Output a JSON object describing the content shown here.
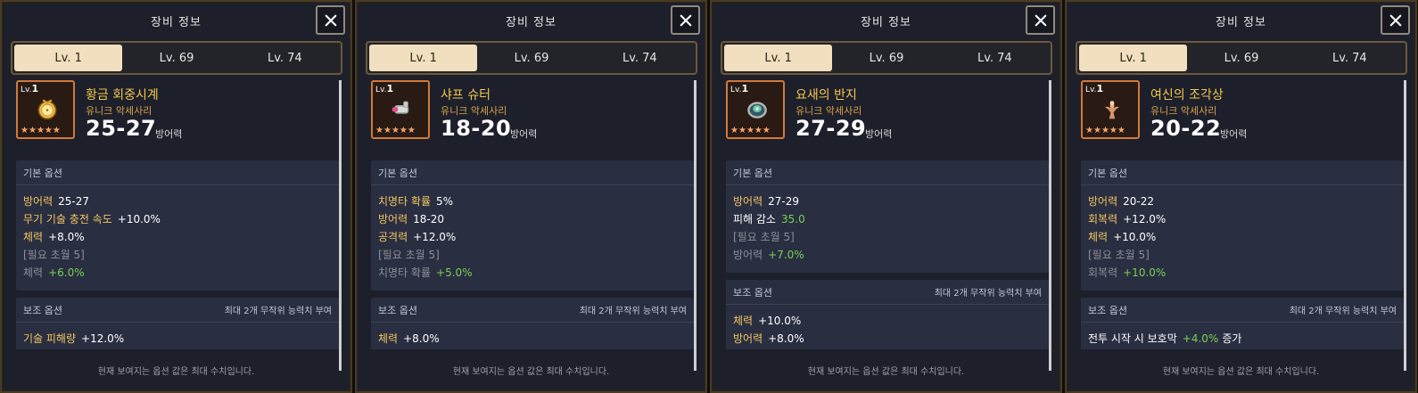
{
  "panels": [
    {
      "title": "장비 정보",
      "tabs": [
        "Lv. 1",
        "Lv. 69",
        "Lv. 74"
      ],
      "active_tab": 0,
      "item": {
        "level_prefix": "Lv.",
        "level": "1",
        "name": "황금 회중시계",
        "type": "유니크 악세사리",
        "defense": "25-27",
        "defense_label": "방어력"
      },
      "basic_options": {
        "title": "기본 옵션",
        "lines": [
          {
            "k": "방어력",
            "v": "25-27"
          },
          {
            "k": "무기 기술 충전 속도",
            "v": "+10.0%"
          },
          {
            "k": "체력",
            "v": "+8.0%"
          },
          {
            "dim": "[필요 초월 5]"
          },
          {
            "k": "체력",
            "v": "+6.0%",
            "dimk": true,
            "green": true
          }
        ]
      },
      "sub_options": {
        "title": "보조 옵션",
        "right": "최대 2개 무작위 능력치 부여",
        "lines": [
          {
            "k": "기술 피해량",
            "v": "+12.0%"
          }
        ]
      },
      "footer": "현재 보여지는 옵션 값은 최대 수치입니다."
    },
    {
      "title": "장비 정보",
      "tabs": [
        "Lv. 1",
        "Lv. 69",
        "Lv. 74"
      ],
      "active_tab": 0,
      "item": {
        "level_prefix": "Lv.",
        "level": "1",
        "name": "샤프 슈터",
        "type": "유니크 악세사리",
        "defense": "18-20",
        "defense_label": "방어력"
      },
      "basic_options": {
        "title": "기본 옵션",
        "lines": [
          {
            "k": "치명타 확률",
            "v": "5%"
          },
          {
            "k": "방어력",
            "v": "18-20"
          },
          {
            "k": "공격력",
            "v": "+12.0%"
          },
          {
            "dim": "[필요 초월 5]"
          },
          {
            "k": "치명타 확률",
            "v": "+5.0%",
            "dimk": true,
            "green": true
          }
        ]
      },
      "sub_options": {
        "title": "보조 옵션",
        "right": "최대 2개 무작위 능력치 부여",
        "lines": [
          {
            "k": "체력",
            "v": "+8.0%"
          }
        ]
      },
      "footer": "현재 보여지는 옵션 값은 최대 수치입니다."
    },
    {
      "title": "장비 정보",
      "tabs": [
        "Lv. 1",
        "Lv. 69",
        "Lv. 74"
      ],
      "active_tab": 0,
      "item": {
        "level_prefix": "Lv.",
        "level": "1",
        "name": "요새의 반지",
        "type": "유니크 악세사리",
        "defense": "27-29",
        "defense_label": "방어력"
      },
      "basic_options": {
        "title": "기본 옵션",
        "lines": [
          {
            "k": "방어력",
            "v": "27-29"
          },
          {
            "kwhite": "피해 감소",
            "v": "35.0",
            "green": true
          },
          {
            "dim": "[필요 초월 5]"
          },
          {
            "k": "방어력",
            "v": "+7.0%",
            "dimk": true,
            "green": true
          }
        ]
      },
      "sub_options": {
        "title": "보조 옵션",
        "right": "최대 2개 무작위 능력치 부여",
        "lines": [
          {
            "k": "체력",
            "v": "+10.0%"
          },
          {
            "k": "방어력",
            "v": "+8.0%"
          }
        ]
      },
      "footer": "현재 보여지는 옵션 값은 최대 수치입니다."
    },
    {
      "title": "장비 정보",
      "tabs": [
        "Lv. 1",
        "Lv. 69",
        "Lv. 74"
      ],
      "active_tab": 0,
      "item": {
        "level_prefix": "Lv.",
        "level": "1",
        "name": "여신의 조각상",
        "type": "유니크 악세사리",
        "defense": "20-22",
        "defense_label": "방어력"
      },
      "basic_options": {
        "title": "기본 옵션",
        "lines": [
          {
            "k": "방어력",
            "v": "20-22"
          },
          {
            "k": "회복력",
            "v": "+12.0%"
          },
          {
            "k": "체력",
            "v": "+10.0%"
          },
          {
            "dim": "[필요 초월 5]"
          },
          {
            "k": "회복력",
            "v": "+10.0%",
            "dimk": true,
            "green": true
          }
        ]
      },
      "sub_options": {
        "title": "보조 옵션",
        "right": "최대 2개 무작위 능력치 부여",
        "lines": [
          {
            "kwhite": "전투 시작 시 보호막",
            "v": "+4.0%",
            "green": true,
            "suffix": "증가"
          }
        ]
      },
      "footer": "현재 보여지는 옵션 값은 최대 수치입니다."
    }
  ],
  "icons": [
    "close-icon",
    "pocket-watch-icon",
    "sharp-shooter-icon",
    "fortress-ring-icon",
    "goddess-statue-icon",
    "star-icon"
  ],
  "colors": {
    "panel_bg": "#1d1f2b",
    "border": "#4a3a22",
    "tab_active": "#f1dfbf",
    "item_name": "#f3c84b",
    "green": "#7ad055"
  }
}
